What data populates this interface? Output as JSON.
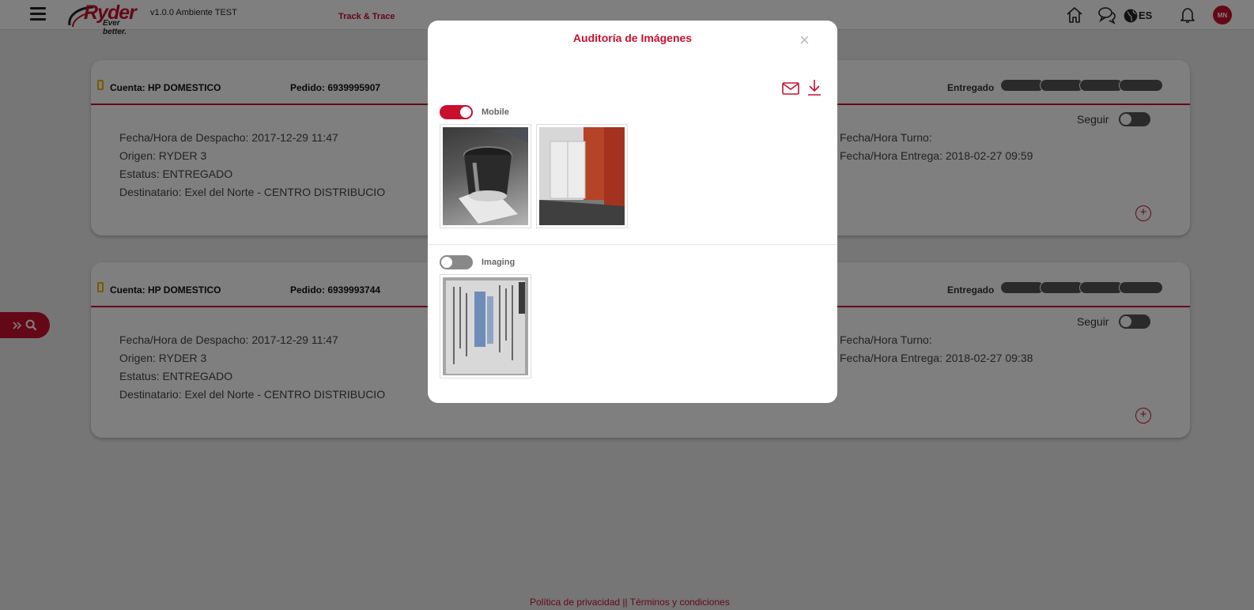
{
  "header": {
    "version": "v1.0.0 Ambiente TEST",
    "nav_link": "Track & Trace",
    "lang": "ES",
    "avatar_initials": "MN",
    "logo_text": "Ryder",
    "logo_tagline": "Ever better."
  },
  "cards": [
    {
      "account": "Cuenta: HP DOMESTICO",
      "order": "Pedido: 6939995907",
      "status_label": "Entregado",
      "follow_label": "Seguir",
      "left_info": [
        "Fecha/Hora de Despacho: 2017-12-29 11:47",
        "Origen: RYDER 3",
        "Estatus: ENTREGADO",
        "Destinatario: Exel del Norte - CENTRO DISTRIBUCIO"
      ],
      "right_info": [
        "Fecha/Hora Turno:",
        "Fecha/Hora Entrega: 2018-02-27 09:59"
      ]
    },
    {
      "account": "Cuenta: HP DOMESTICO",
      "order": "Pedido: 6939993744",
      "status_label": "Entregado",
      "follow_label": "Seguir",
      "left_info": [
        "Fecha/Hora de Despacho: 2017-12-29 11:47",
        "Origen: RYDER 3",
        "Estatus: ENTREGADO",
        "Destinatario: Exel del Norte - CENTRO DISTRIBUCIO"
      ],
      "right_info": [
        "Fecha/Hora Turno:",
        "Fecha/Hora Entrega: 2018-02-27 09:38"
      ]
    }
  ],
  "footer": {
    "privacy": "Política de privacidad",
    "separator": " || ",
    "terms": "Términos y condiciones"
  },
  "modal": {
    "title": "Auditoría de Imágenes",
    "close": "×",
    "sections": [
      {
        "label": "Mobile",
        "enabled": true
      },
      {
        "label": "Imaging",
        "enabled": false
      }
    ]
  },
  "colors": {
    "brand": "#c8102e",
    "accent_phone": "#f0b400",
    "progress": "#555555"
  }
}
